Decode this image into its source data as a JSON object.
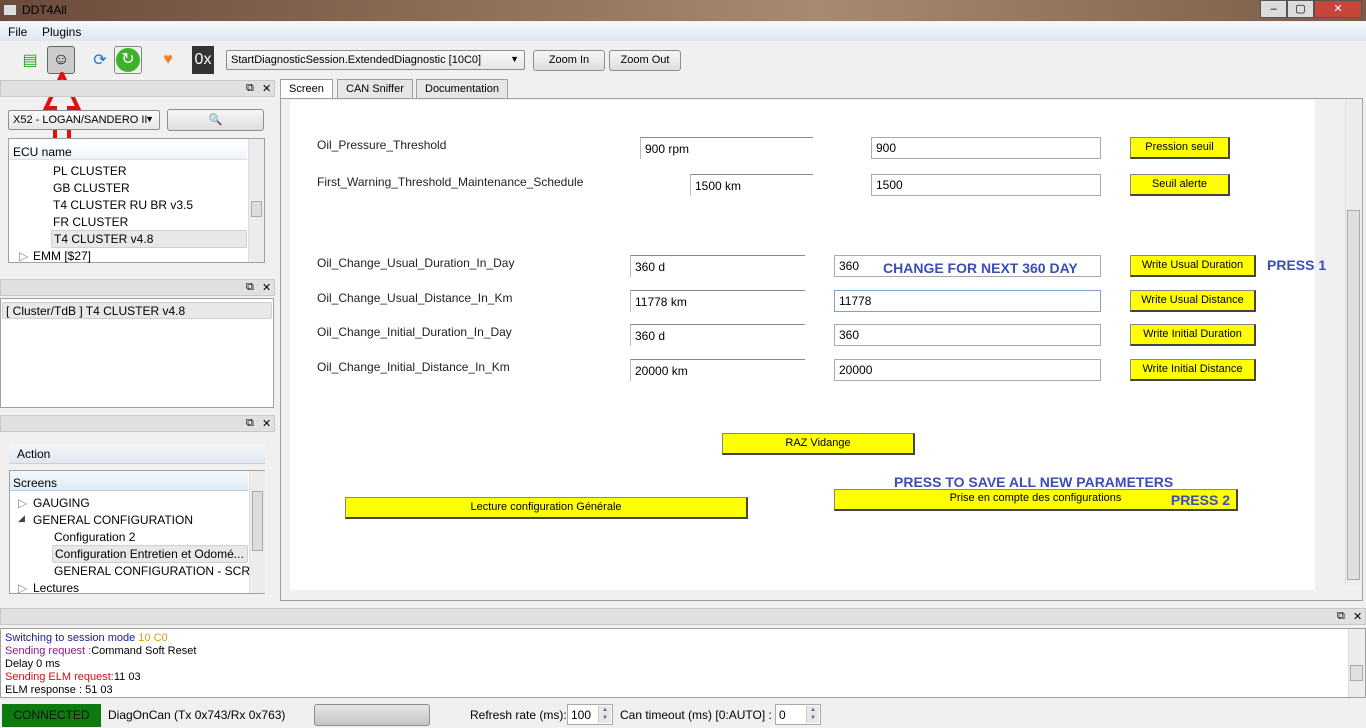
{
  "window": {
    "title": "DDT4All"
  },
  "menu": [
    "File",
    "Plugins"
  ],
  "toolbar": {
    "session": "StartDiagnosticSession.ExtendedDiagnostic [10C0]",
    "zoom_in": "Zoom In",
    "zoom_out": "Zoom Out",
    "hex_label": "0x"
  },
  "left": {
    "vehicle": "X52 - LOGAN/SANDERO II",
    "ecu_header": "ECU name",
    "ecu_items": [
      "PL CLUSTER",
      "GB CLUSTER",
      "T4 CLUSTER RU BR v3.5",
      "FR CLUSTER",
      "T4 CLUSTER v4.8",
      "EMM [$27]"
    ],
    "selected_ecu": "[ Cluster/TdB ] T4 CLUSTER v4.8",
    "action_tab": "Action",
    "screens_header": "Screens",
    "screens": [
      "GAUGING",
      "GENERAL CONFIGURATION",
      "Configuration 2",
      "Configuration Entretien et Odomé...",
      "GENERAL CONFIGURATION - SCR...",
      "Lectures"
    ]
  },
  "tabs": [
    "Screen",
    "CAN Sniffer",
    "Documentation"
  ],
  "screen": {
    "rows": [
      {
        "label": "Oil_Pressure_Threshold",
        "current": "900 rpm",
        "input": "900",
        "button": "Pression seuil"
      },
      {
        "label": "First_Warning_Threshold_Maintenance_Schedule",
        "current": "1500 km",
        "input": "1500",
        "button": "Seuil alerte"
      },
      {
        "label": "Oil_Change_Usual_Duration_In_Day",
        "current": "360 d",
        "input": "360",
        "button": "Write Usual Duration"
      },
      {
        "label": "Oil_Change_Usual_Distance_In_Km",
        "current": "11778 km",
        "input": "11778",
        "button": "Write Usual Distance"
      },
      {
        "label": "Oil_Change_Initial_Duration_In_Day",
        "current": "360 d",
        "input": "360",
        "button": "Write Initial Duration"
      },
      {
        "label": "Oil_Change_Initial_Distance_In_Km",
        "current": "20000 km",
        "input": "20000",
        "button": "Write Initial Distance"
      }
    ],
    "note_change": "CHANGE FOR NEXT 360 DAY",
    "press1": "PRESS 1",
    "raz": "RAZ Vidange",
    "note_save": "PRESS TO SAVE ALL NEW PARAMETERS",
    "prise": "Prise en compte des configurations",
    "press2": "PRESS 2",
    "lecture": "Lecture configuration Générale"
  },
  "log": [
    {
      "a": "Switching to session mode ",
      "b": "10 C0",
      "ca": "#1a1aa0",
      "cb": "#e0a000"
    },
    {
      "a": "Sending request :",
      "b": "Command Soft Reset",
      "ca": "#8a1a8a",
      "cb": "#000"
    },
    {
      "a": "Delay 0 ms",
      "b": "",
      "ca": "#000",
      "cb": "#000"
    },
    {
      "a": "Sending ELM request:",
      "b": "11 03",
      "ca": "#d01010",
      "cb": "#000"
    },
    {
      "a": "ELM response : 51 03",
      "b": "",
      "ca": "#000",
      "cb": "#000"
    }
  ],
  "status": {
    "connected": "CONNECTED",
    "protocol": "DiagOnCan (Tx 0x743/Rx 0x763)",
    "refresh_label": "Refresh rate (ms):",
    "refresh": "100",
    "timeout_label": "Can timeout (ms) [0:AUTO] :",
    "timeout": "0"
  }
}
